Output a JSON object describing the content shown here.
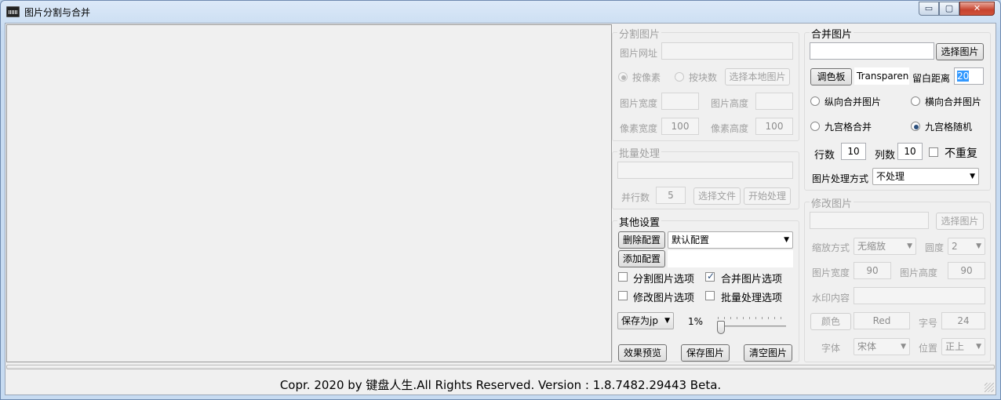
{
  "window": {
    "title": "图片分割与合并",
    "min_glyph": "▭",
    "max_glyph": "▢",
    "close_glyph": "✕"
  },
  "split": {
    "title": "分割图片",
    "url_label": "图片网址",
    "url_value": "",
    "by_pixel": "按像素",
    "by_block": "按块数",
    "local_button": "选择本地图片",
    "img_width_label": "图片宽度",
    "img_width_value": "",
    "img_height_label": "图片高度",
    "img_height_value": "",
    "px_width_label": "像素宽度",
    "px_width_value": "100",
    "px_height_label": "像素高度",
    "px_height_value": "100"
  },
  "batch": {
    "title": "批量处理",
    "path_value": "",
    "threads_label": "并行数",
    "threads_value": "5",
    "select_file_button": "选择文件",
    "start_button": "开始处理"
  },
  "other": {
    "title": "其他设置",
    "delete_config_button": "删除配置",
    "config_select": "默认配置",
    "add_config_button": "添加配置",
    "config_name_value": "",
    "opt_split": "分割图片选项",
    "opt_merge": "合并图片选项",
    "opt_modify": "修改图片选项",
    "opt_batch": "批量处理选项",
    "save_format": "保存为jp",
    "quality": "1%",
    "preview_button": "效果预览",
    "save_button": "保存图片",
    "clear_button": "清空图片"
  },
  "merge": {
    "title": "合并图片",
    "path_value": "",
    "select_button": "选择图片",
    "palette_button": "调色板",
    "color_value": "Transparen",
    "margin_label": "留白距离",
    "margin_value": "20",
    "vertical": "纵向合并图片",
    "horizontal": "横向合并图片",
    "nine_merge": "九宫格合并",
    "nine_random": "九宫格随机",
    "rows_label": "行数",
    "rows_value": "10",
    "cols_label": "列数",
    "cols_value": "10",
    "no_repeat": "不重复",
    "process_label": "图片处理方式",
    "process_select": "不处理"
  },
  "modify": {
    "title": "修改图片",
    "path_value": "",
    "select_button": "选择图片",
    "scale_label": "缩放方式",
    "scale_select": "无缩放",
    "radius_label": "圆度",
    "radius_select": "2",
    "width_label": "图片宽度",
    "width_value": "90",
    "height_label": "图片高度",
    "height_value": "90",
    "watermark_label": "水印内容",
    "watermark_value": "",
    "color_button": "颜色",
    "color_value": "Red",
    "fontsize_label": "字号",
    "fontsize_value": "24",
    "font_label": "字体",
    "font_select": "宋体",
    "position_label": "位置",
    "position_select": "正上"
  },
  "status": {
    "text": "Copr. 2020 by 键盘人生.All Rights Reserved.  Version : 1.8.7482.29443 Beta."
  }
}
